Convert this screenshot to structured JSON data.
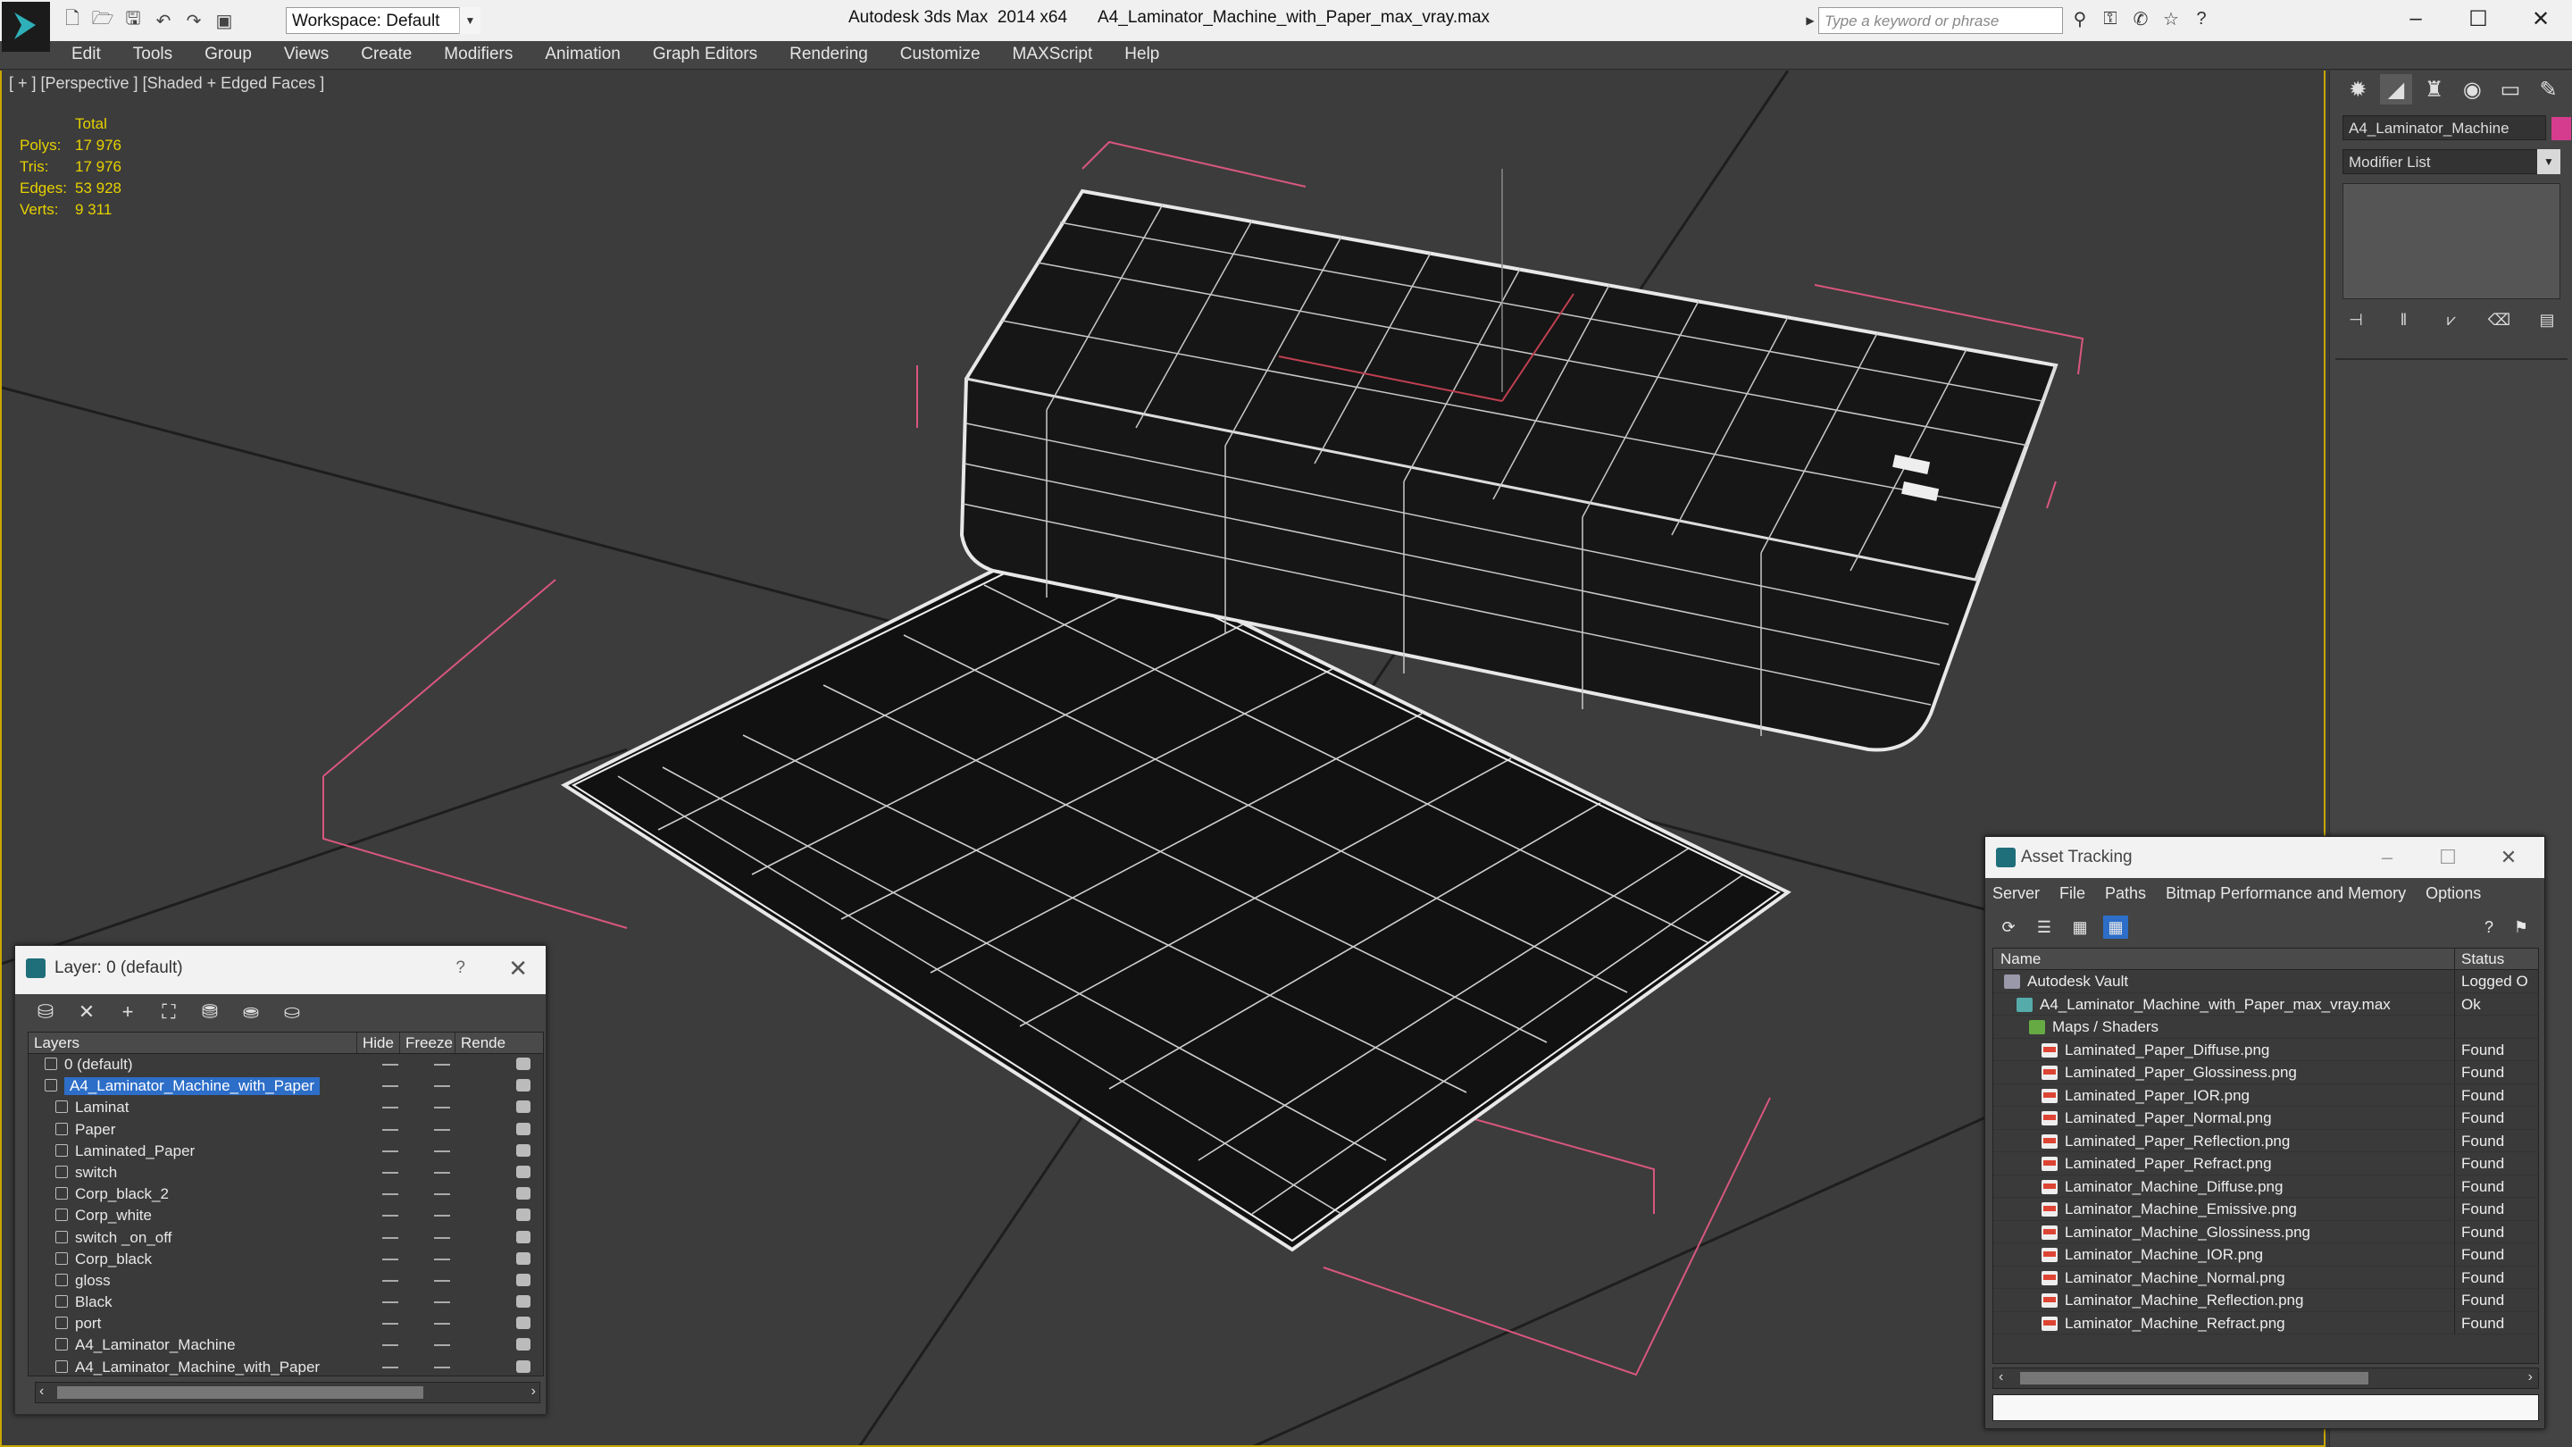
{
  "title": {
    "app": "Autodesk 3ds Max  2014 x64",
    "file": "A4_Laminator_Machine_with_Paper_max_vray.max",
    "workspace": "Workspace: Default",
    "search_placeholder": "Type a keyword or phrase"
  },
  "menu": [
    "Edit",
    "Tools",
    "Group",
    "Views",
    "Create",
    "Modifiers",
    "Animation",
    "Graph Editors",
    "Rendering",
    "Customize",
    "MAXScript",
    "Help"
  ],
  "viewport": {
    "label": "[ + ] [Perspective ] [Shaded + Edged Faces ]",
    "stats": {
      "header": "Total",
      "rows": [
        {
          "key": "Polys:",
          "value": "17 976"
        },
        {
          "key": "Tris:",
          "value": "17 976"
        },
        {
          "key": "Edges:",
          "value": "53 928"
        },
        {
          "key": "Verts:",
          "value": "9 311"
        }
      ]
    }
  },
  "command_panel": {
    "object_name": "A4_Laminator_Machine",
    "object_color": "#d63c8e",
    "modifier_list": "Modifier List"
  },
  "layer_explorer": {
    "title": "Layer: 0 (default)",
    "help": "?",
    "columns": [
      "Layers",
      "Hide",
      "Freeze",
      "Rende"
    ],
    "rows": [
      {
        "name": "0 (default)",
        "indent": 1,
        "selected": false
      },
      {
        "name": "A4_Laminator_Machine_with_Paper",
        "indent": 1,
        "selected": true
      },
      {
        "name": "Laminat",
        "indent": 2,
        "selected": false
      },
      {
        "name": "Paper",
        "indent": 2,
        "selected": false
      },
      {
        "name": "Laminated_Paper",
        "indent": 2,
        "selected": false
      },
      {
        "name": "switch",
        "indent": 2,
        "selected": false
      },
      {
        "name": "Corp_black_2",
        "indent": 2,
        "selected": false
      },
      {
        "name": "Corp_white",
        "indent": 2,
        "selected": false
      },
      {
        "name": "switch _on_off",
        "indent": 2,
        "selected": false
      },
      {
        "name": "Corp_black",
        "indent": 2,
        "selected": false
      },
      {
        "name": "gloss",
        "indent": 2,
        "selected": false
      },
      {
        "name": "Black",
        "indent": 2,
        "selected": false
      },
      {
        "name": "port",
        "indent": 2,
        "selected": false
      },
      {
        "name": "A4_Laminator_Machine",
        "indent": 2,
        "selected": false
      },
      {
        "name": "A4_Laminator_Machine_with_Paper",
        "indent": 2,
        "selected": false
      }
    ]
  },
  "asset_tracking": {
    "title": "Asset Tracking",
    "menu": [
      "Server",
      "File",
      "Paths",
      "Bitmap Performance and Memory",
      "Options"
    ],
    "columns": {
      "name": "Name",
      "status": "Status"
    },
    "rows": [
      {
        "name": "Autodesk Vault",
        "status": "Logged O",
        "indent": 1,
        "icon": "vault"
      },
      {
        "name": "A4_Laminator_Machine_with_Paper_max_vray.max",
        "status": "Ok",
        "indent": 2,
        "icon": "file"
      },
      {
        "name": "Maps / Shaders",
        "status": "",
        "indent": 3,
        "icon": "folder"
      },
      {
        "name": "Laminated_Paper_Diffuse.png",
        "status": "Found",
        "indent": 4,
        "icon": "png"
      },
      {
        "name": "Laminated_Paper_Glossiness.png",
        "status": "Found",
        "indent": 4,
        "icon": "png"
      },
      {
        "name": "Laminated_Paper_IOR.png",
        "status": "Found",
        "indent": 4,
        "icon": "png"
      },
      {
        "name": "Laminated_Paper_Normal.png",
        "status": "Found",
        "indent": 4,
        "icon": "png"
      },
      {
        "name": "Laminated_Paper_Reflection.png",
        "status": "Found",
        "indent": 4,
        "icon": "png"
      },
      {
        "name": "Laminated_Paper_Refract.png",
        "status": "Found",
        "indent": 4,
        "icon": "png"
      },
      {
        "name": "Laminator_Machine_Diffuse.png",
        "status": "Found",
        "indent": 4,
        "icon": "png"
      },
      {
        "name": "Laminator_Machine_Emissive.png",
        "status": "Found",
        "indent": 4,
        "icon": "png"
      },
      {
        "name": "Laminator_Machine_Glossiness.png",
        "status": "Found",
        "indent": 4,
        "icon": "png"
      },
      {
        "name": "Laminator_Machine_IOR.png",
        "status": "Found",
        "indent": 4,
        "icon": "png"
      },
      {
        "name": "Laminator_Machine_Normal.png",
        "status": "Found",
        "indent": 4,
        "icon": "png"
      },
      {
        "name": "Laminator_Machine_Reflection.png",
        "status": "Found",
        "indent": 4,
        "icon": "png"
      },
      {
        "name": "Laminator_Machine_Refract.png",
        "status": "Found",
        "indent": 4,
        "icon": "png"
      }
    ]
  }
}
